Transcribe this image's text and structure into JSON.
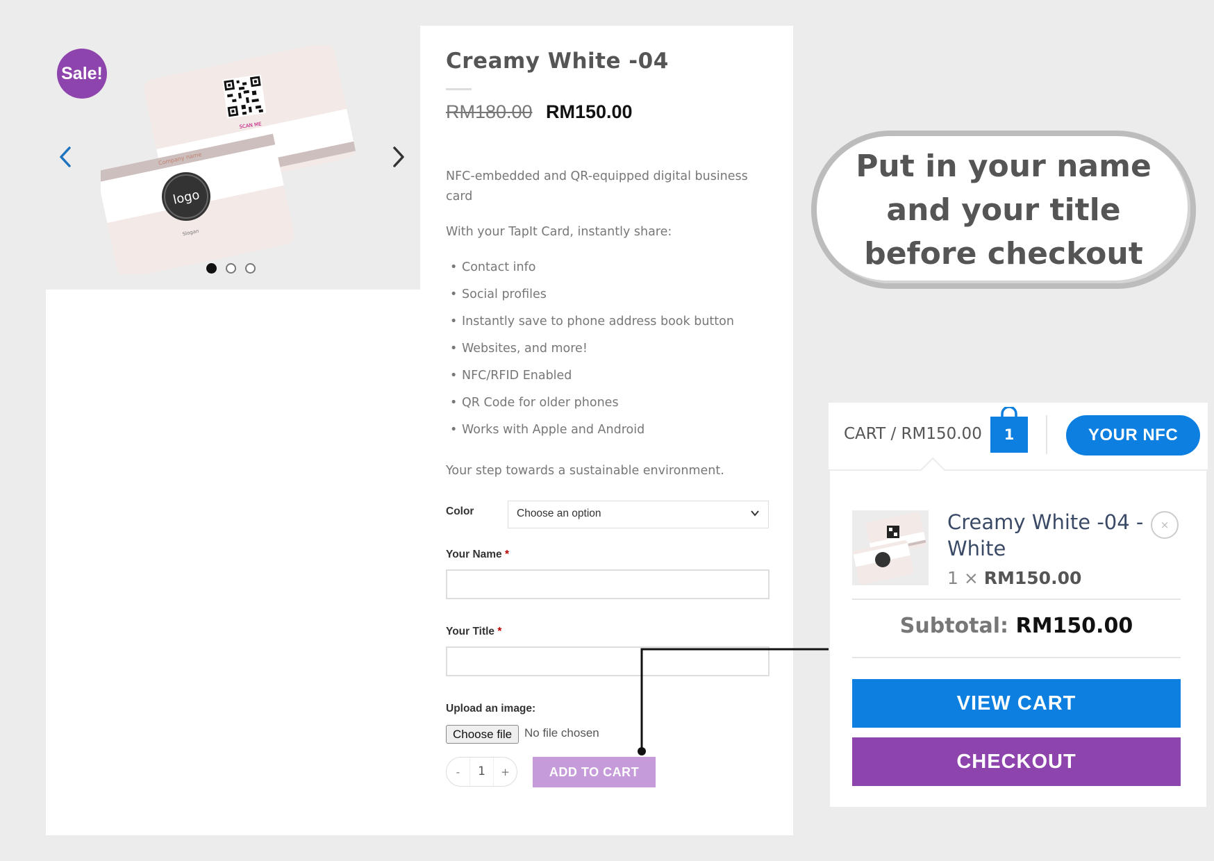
{
  "gallery": {
    "sale_badge": "Sale!",
    "card_company_name": "Company name",
    "card_logo_text": "logo",
    "card_slogan": "Slogan",
    "card_scan_me": "SCAN ME"
  },
  "product": {
    "title": "Creamy White -04",
    "price_old": "RM180.00",
    "price_new": "RM150.00",
    "description": "NFC-embedded and QR-equipped digital business card",
    "share_intro": "With your TapIt Card, instantly share:",
    "features": [
      "Contact info",
      "Social profiles",
      "Instantly save to phone address book button",
      "Websites, and more!",
      "NFC/RFID Enabled",
      "QR Code for older phones",
      "Works with Apple and Android"
    ],
    "closing": "Your step towards a sustainable environment."
  },
  "form": {
    "color_label": "Color",
    "color_select_value": "Choose an option",
    "name_label": "Your Name",
    "title_label": "Your Title",
    "required_mark": "*",
    "upload_label": "Upload an image:",
    "choose_file": "Choose file",
    "no_file": "No file chosen",
    "qty_minus": "-",
    "qty_value": "1",
    "qty_plus": "+",
    "add_to_cart": "ADD TO CART"
  },
  "callout": {
    "text": "Put in your name and your title before checkout"
  },
  "cart": {
    "header_label": "CART / RM150.00",
    "count": "1",
    "nfc_button": "YOUR NFC",
    "item_name": "Creamy White -04 - White",
    "item_qty": "1 ×",
    "item_price": "RM150.00",
    "remove": "×",
    "subtotal_label": "Subtotal:",
    "subtotal_value": "RM150.00",
    "view_cart": "VIEW CART",
    "checkout": "CHECKOUT"
  },
  "colors": {
    "accent_purple": "#8e44ad",
    "accent_blue": "#0d7fe0",
    "add_to_cart_bg": "#c59bd9"
  }
}
